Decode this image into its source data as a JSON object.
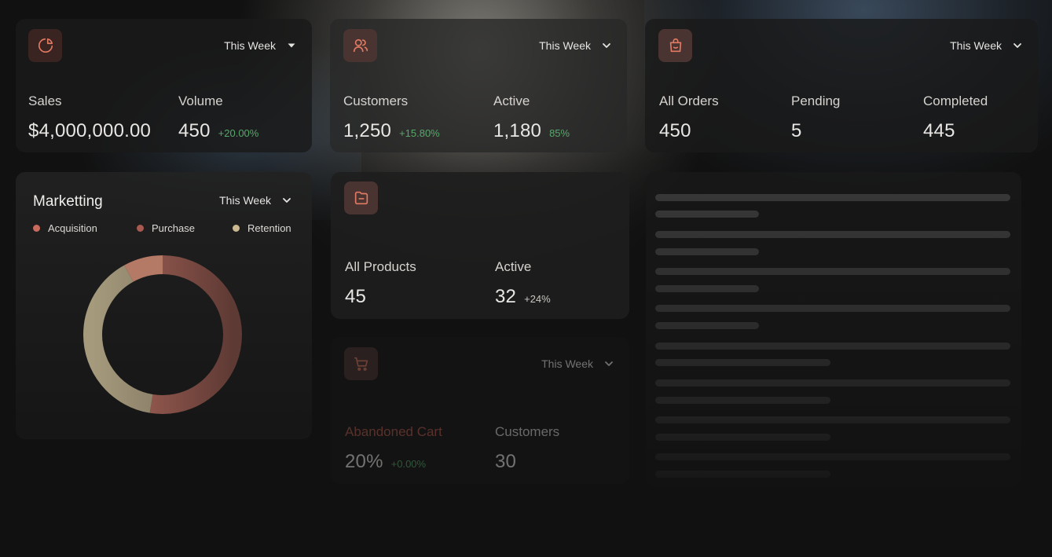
{
  "colors": {
    "accent": "#e07a62",
    "positive": "#58a86a",
    "acquisition": "#c86a5c",
    "purchase": "#a85a50",
    "retention": "#c9b890"
  },
  "sales_card": {
    "icon": "pie-chart-icon",
    "period": "This Week",
    "sales_label": "Sales",
    "sales_value": "$4,000,000.00",
    "volume_label": "Volume",
    "volume_value": "450",
    "volume_change": "+20.00%"
  },
  "customers_card": {
    "icon": "users-icon",
    "period": "This Week",
    "customers_label": "Customers",
    "customers_value": "1,250",
    "customers_change": "+15.80%",
    "active_label": "Active",
    "active_value": "1,180",
    "active_percent": "85%"
  },
  "orders_card": {
    "icon": "shopping-bag-icon",
    "period": "This Week",
    "all_label": "All Orders",
    "all_value": "450",
    "pending_label": "Pending",
    "pending_value": "5",
    "completed_label": "Completed",
    "completed_value": "445"
  },
  "marketing_card": {
    "title": "Marketting",
    "period": "This Week",
    "legend": [
      "Acquisition",
      "Purchase",
      "Retention"
    ]
  },
  "products_card": {
    "icon": "folder-icon",
    "all_label": "All Products",
    "all_value": "45",
    "active_label": "Active",
    "active_value": "32",
    "active_change": "+24%"
  },
  "cart_card": {
    "icon": "shopping-cart-icon",
    "period": "This Week",
    "abandoned_label": "Abandoned Cart",
    "abandoned_value": "20%",
    "abandoned_change": "+0.00%",
    "customers_label": "Customers",
    "customers_value": "30"
  }
}
